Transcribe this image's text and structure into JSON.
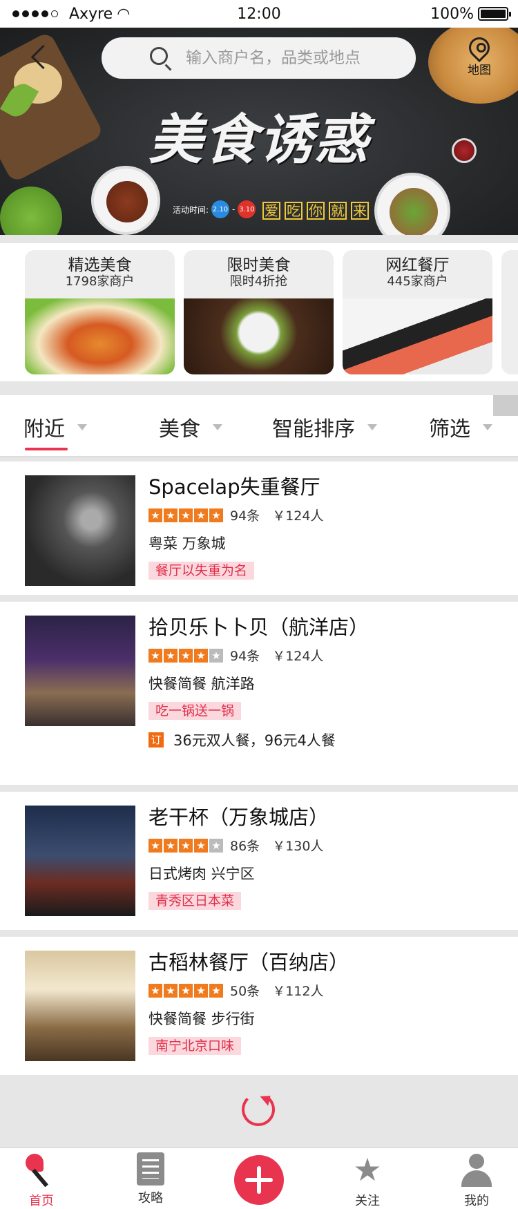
{
  "status": {
    "carrier": "Axyre",
    "time": "12:00",
    "battery": "100%"
  },
  "search": {
    "placeholder": "输入商户名，品类或地点",
    "map_label": "地图"
  },
  "banner": {
    "title": "美食诱惑",
    "activity_label": "活动时间:",
    "date_start": "2.10",
    "date_end": "3.10",
    "slogan": [
      "爱",
      "吃",
      "你",
      "就",
      "来"
    ]
  },
  "categories": [
    {
      "name": "精选美食",
      "sub": "1798家商户"
    },
    {
      "name": "限时美食",
      "sub": "限时4折抢"
    },
    {
      "name": "网红餐厅",
      "sub": "445家商户"
    }
  ],
  "filters": [
    "附近",
    "美食",
    "智能排序",
    "筛选"
  ],
  "restaurants": [
    {
      "name": "Spacelap失重餐厅",
      "stars": 5,
      "reviews": "94条",
      "price": "￥124人",
      "meta": "粤菜  万象城",
      "tag": "餐厅以失重为名",
      "deal": ""
    },
    {
      "name": "拾贝乐卜卜贝（航洋店）",
      "stars": 4.5,
      "reviews": "94条",
      "price": "￥124人",
      "meta": "快餐简餐  航洋路",
      "tag": "吃一锅送一锅",
      "deal_icon": "订",
      "deal": "36元双人餐，96元4人餐"
    },
    {
      "name": "老干杯（万象城店）",
      "stars": 4,
      "reviews": "86条",
      "price": "￥130人",
      "meta": "日式烤肉  兴宁区",
      "tag": "青秀区日本菜",
      "deal": ""
    },
    {
      "name": "古稻林餐厅（百纳店）",
      "stars": 5,
      "reviews": "50条",
      "price": "￥112人",
      "meta": "快餐简餐  步行街",
      "tag": "南宁北京口味",
      "deal": ""
    }
  ],
  "nav": {
    "home": "首页",
    "guide": "攻略",
    "follow": "关注",
    "me": "我的"
  },
  "colors": {
    "accent": "#e8344f",
    "star": "#f07a1e"
  }
}
